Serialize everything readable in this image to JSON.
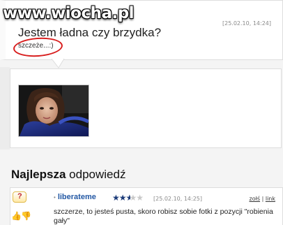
{
  "question": {
    "date": "[25.02.10, 14:24]",
    "title": "Jestem ładna czy brzydka?",
    "body": "szczeże...:)"
  },
  "best_answer": {
    "heading_bold": "Najlepsza",
    "heading_rest": " odpowiedź",
    "user": "liberateme",
    "rating_stars": 2.5,
    "rating_max": 5,
    "date": "[25.02.10, 14:25]",
    "link_bad": "zołś",
    "link_sep": " | ",
    "link_link": "link",
    "text": "szczerze, to jesteś pusta, skoro robisz sobie fotki z pozycji \"robienia gały\""
  },
  "icons": {
    "question_badge": "question-mark-icon",
    "thumb_up": "thumb-up-icon",
    "thumb_down": "thumb-down-icon"
  },
  "watermark": {
    "text": "www.wiocha.pl"
  },
  "colors": {
    "highlight_circle": "#d81e1e",
    "username": "#2358a4",
    "star": "#1d3c7a"
  }
}
